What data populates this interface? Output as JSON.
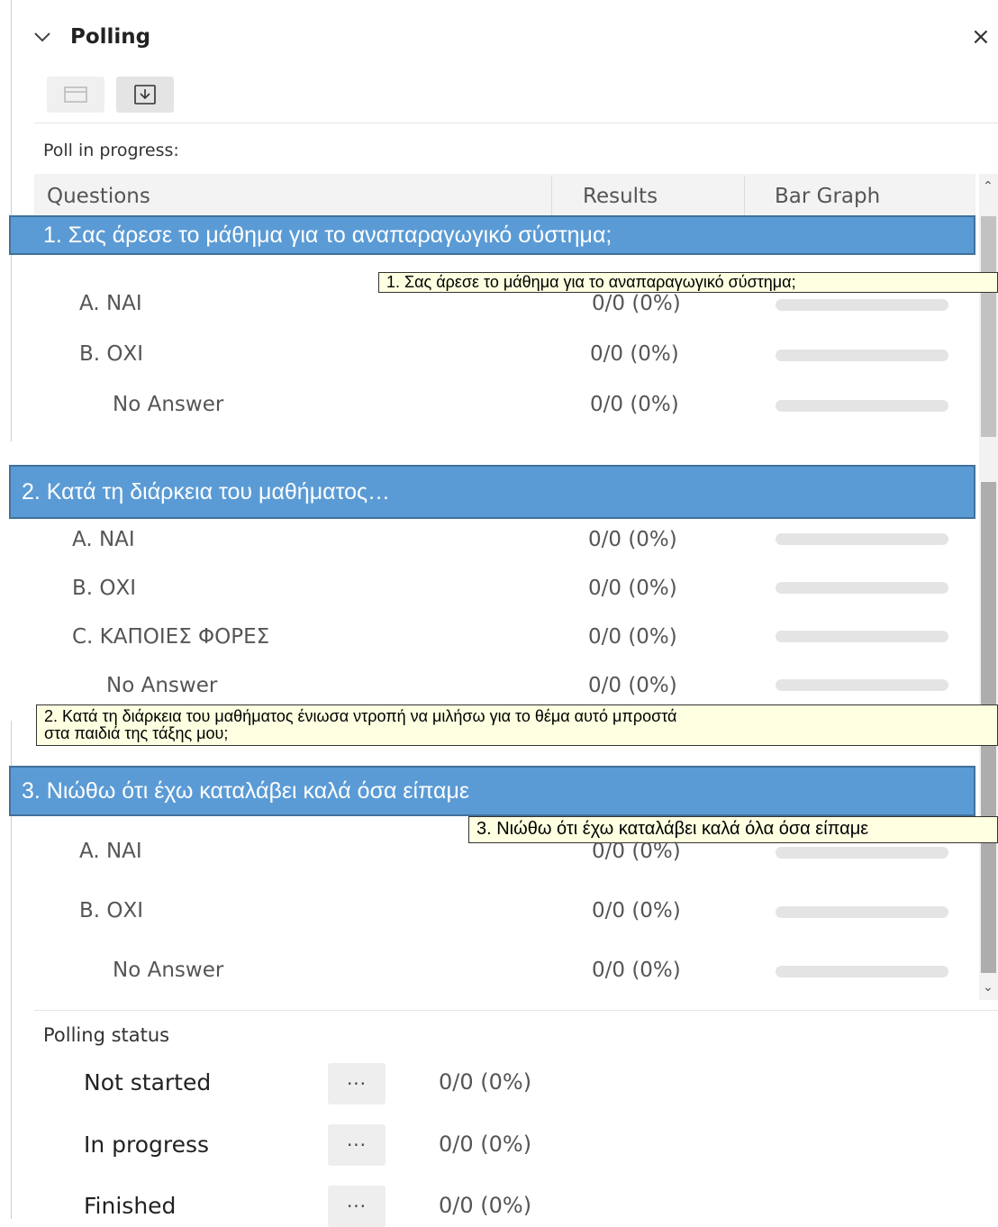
{
  "panel": {
    "title": "Polling",
    "close_glyph": "×"
  },
  "toolbar": {
    "icons": [
      "folder-icon",
      "download-icon"
    ]
  },
  "poll_label": "Poll in progress:",
  "table_headers": {
    "questions": "Questions",
    "results": "Results",
    "bar_graph": "Bar Graph"
  },
  "questions": [
    {
      "banner": "1.   Σας άρεσε το μάθημα για το αναπαραγωγικό σύστημα;",
      "tooltip": "1.  Σας άρεσε το μάθημα για το αναπαραγωγικό σύστημα;",
      "options": [
        {
          "label": "A.   ΝΑΙ",
          "result": "0/0 (0%)",
          "percent": 0
        },
        {
          "label": "B.   ΟΧΙ",
          "result": "0/0 (0%)",
          "percent": 0
        },
        {
          "label": "No Answer",
          "result": "0/0 (0%)",
          "percent": 0
        }
      ]
    },
    {
      "banner": "2. Κατά τη διάρκεια του μαθήματος…",
      "tooltip_line1": "2.  Κατά τη διάρκεια του μαθήματος ένιωσα ντροπή να μιλήσω για το θέμα αυτό μπροστά",
      "tooltip_line2": "στα παιδιά της τάξης μου;",
      "options": [
        {
          "label": "A.   ΝΑΙ",
          "result": "0/0 (0%)",
          "percent": 0
        },
        {
          "label": "B.   ΟΧΙ",
          "result": "0/0 (0%)",
          "percent": 0
        },
        {
          "label": "C.   ΚΑΠΟΙΕΣ ΦΟΡΕΣ",
          "result": "0/0 (0%)",
          "percent": 0
        },
        {
          "label": "No Answer",
          "result": "0/0 (0%)",
          "percent": 0
        }
      ]
    },
    {
      "banner": "3. Νιώθω ότι έχω καταλάβει καλά όσα είπαμε",
      "tooltip": "3.  Νιώθω ότι έχω καταλάβει καλά όλα όσα είπαμε",
      "options": [
        {
          "label": "A.   ΝΑΙ",
          "result": "0/0 (0%)",
          "percent": 0
        },
        {
          "label": "B.   ΟΧΙ",
          "result": "0/0 (0%)",
          "percent": 0
        },
        {
          "label": "No Answer",
          "result": "0/0 (0%)",
          "percent": 0
        }
      ]
    }
  ],
  "polling_status": {
    "title": "Polling status",
    "more_glyph": "···",
    "rows": [
      {
        "label": "Not started",
        "value": "0/0 (0%)"
      },
      {
        "label": "In progress",
        "value": "0/0 (0%)"
      },
      {
        "label": "Finished",
        "value": "0/0 (0%)"
      }
    ]
  }
}
